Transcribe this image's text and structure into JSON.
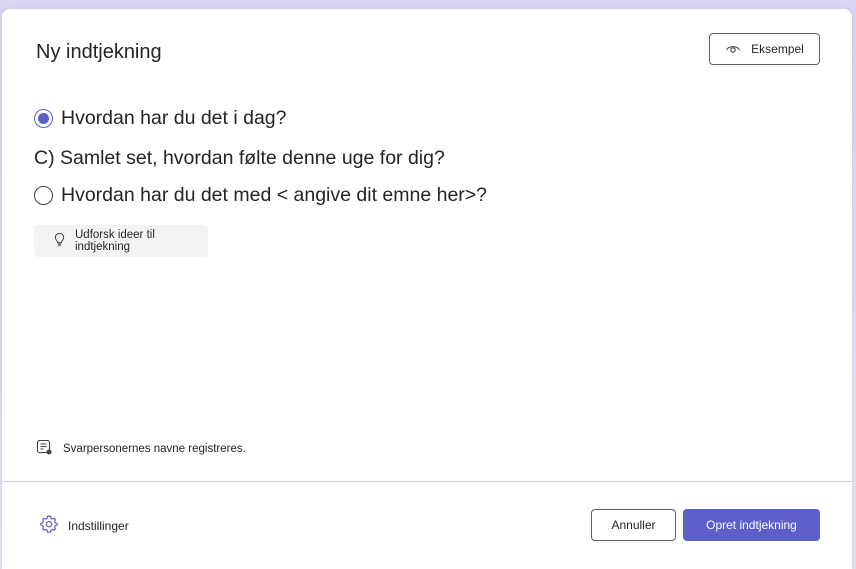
{
  "dialog": {
    "title": "Ny indtjekning",
    "preview_label": "Eksempel"
  },
  "questions": [
    {
      "text": "Hvordan har du det i dag?",
      "selected": true
    },
    {
      "text": "C) Samlet set, hvordan følte denne uge for dig?"
    },
    {
      "text": "Hvordan har du det med < angive dit emne her>?",
      "selected": false
    }
  ],
  "explore": {
    "label": "Udforsk ideer til indtjekning"
  },
  "note": {
    "text": "Svarpersonernes navne registreres."
  },
  "footer": {
    "settings_label": "Indstillinger",
    "cancel_label": "Annuller",
    "create_label": "Opret indtjekning"
  },
  "colors": {
    "accent": "#5b5fc7",
    "primary_text": "#242424",
    "background": "#d9d4f0"
  },
  "icons": {
    "preview": "eye-icon",
    "explore": "lightbulb-icon",
    "note": "form-list-icon",
    "settings": "gear-icon"
  }
}
